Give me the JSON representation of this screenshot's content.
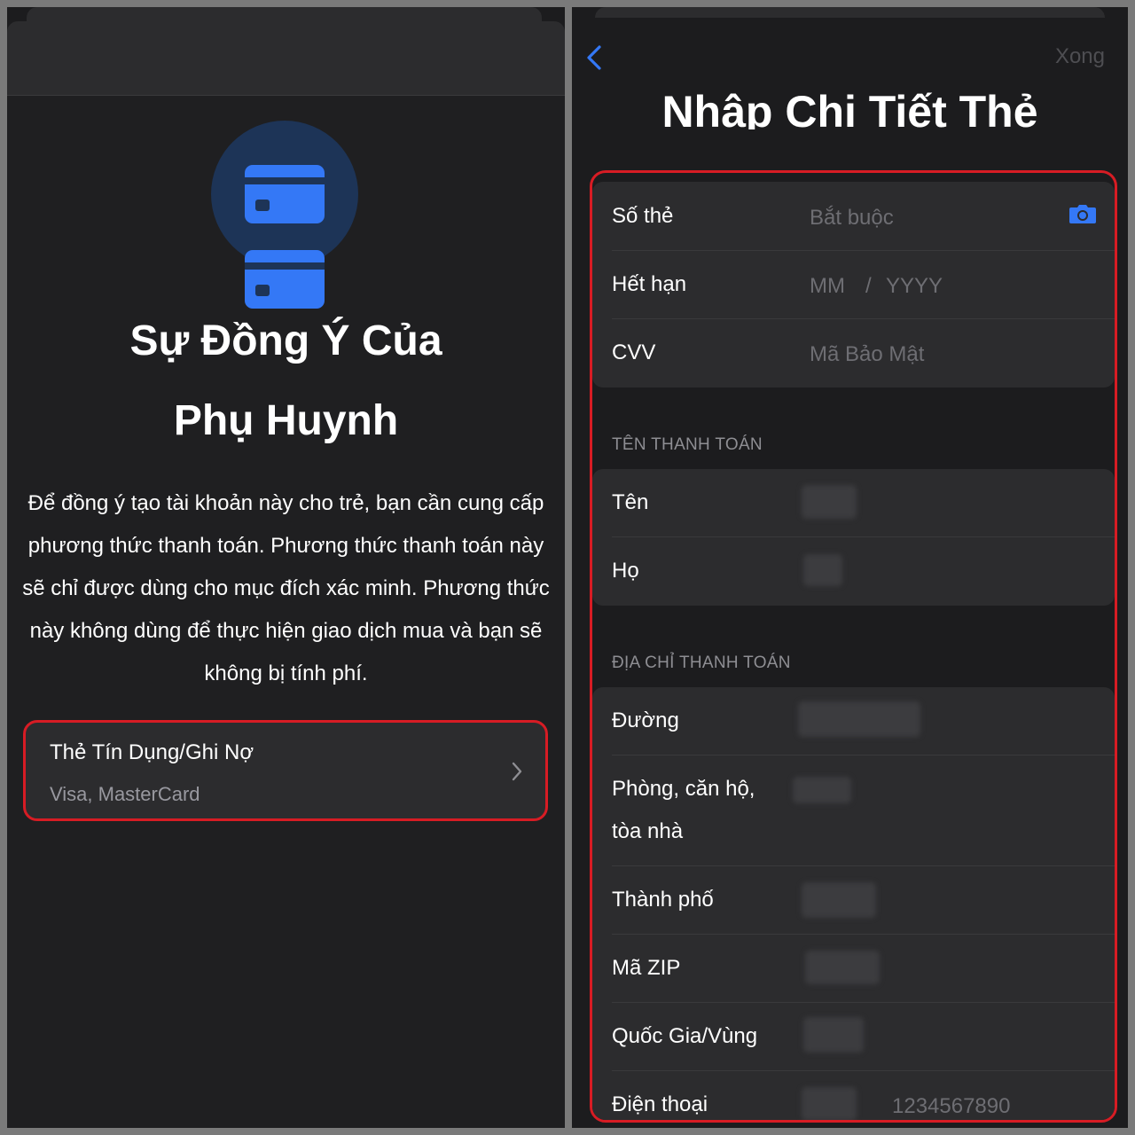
{
  "left": {
    "title_line1": "Sự Đồng Ý Của",
    "title_line2": "Phụ Huynh",
    "description": "Để đồng ý tạo tài khoản này cho trẻ, bạn cần cung cấp phương thức thanh toán. Phương thức thanh toán này sẽ chỉ được dùng cho mục đích xác minh. Phương thức này không dùng để thực hiện giao dịch mua và bạn sẽ không bị tính phí.",
    "option": {
      "title": "Thẻ Tín Dụng/Ghi Nợ",
      "subtitle": "Visa, MasterCard"
    },
    "icons": [
      "credit-card-icon",
      "chevron-right-icon"
    ],
    "colors": {
      "accent": "#3478f6",
      "highlight": "#d71c24"
    }
  },
  "right": {
    "done_label": "Xong",
    "title": "Nhập Chi Tiết Thẻ",
    "card_fields": {
      "number_label": "Số thẻ",
      "number_placeholder": "Bắt buộc",
      "expiry_label": "Hết hạn",
      "expiry_month_placeholder": "MM",
      "expiry_separator": "/",
      "expiry_year_placeholder": "YYYY",
      "cvv_label": "CVV",
      "cvv_placeholder": "Mã Bảo Mật"
    },
    "billing_name": {
      "header": "TÊN THANH TOÁN",
      "first_label": "Tên",
      "last_label": "Họ"
    },
    "billing_address": {
      "header": "ĐỊA CHỈ THANH TOÁN",
      "street_label": "Đường",
      "apt_label_line1": "Phòng, căn hộ,",
      "apt_label_line2": "tòa nhà",
      "city_label": "Thành phố",
      "zip_label": "Mã ZIP",
      "country_label": "Quốc Gia/Vùng",
      "phone_label": "Điện thoại",
      "phone_placeholder": "1234567890"
    },
    "icons": [
      "chevron-left-icon",
      "camera-icon"
    ]
  }
}
